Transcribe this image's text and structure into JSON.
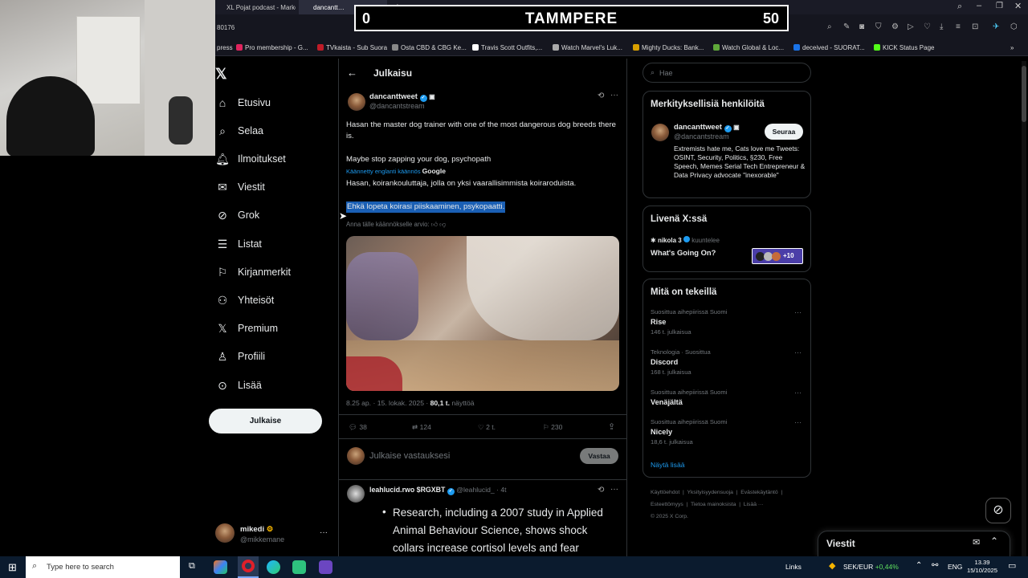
{
  "browser": {
    "tabs": [
      "XL Pojat podcast - Marko",
      "dancantt…"
    ],
    "address_text": "80176",
    "bookmarks": [
      "press",
      "Pro membership - G...",
      "TVkaista - Sub Suora",
      "Osta CBD & CBG Ke...",
      "Travis Scott Outfits,...",
      "Watch Marvel's Luk...",
      "Mighty Ducks: Bank...",
      "Watch Global & Loc...",
      "deceived - SUORAT...",
      "KICK Status Page"
    ]
  },
  "scoreboard": {
    "left": "0",
    "center": "TAMMPERE",
    "right": "50"
  },
  "nav": {
    "items": [
      {
        "label": "Etusivu",
        "icon": "home-icon"
      },
      {
        "label": "Selaa",
        "icon": "search-icon"
      },
      {
        "label": "Ilmoitukset",
        "icon": "bell-icon"
      },
      {
        "label": "Viestit",
        "icon": "mail-icon"
      },
      {
        "label": "Grok",
        "icon": "grok-icon"
      },
      {
        "label": "Listat",
        "icon": "list-icon"
      },
      {
        "label": "Kirjanmerkit",
        "icon": "bookmark-icon"
      },
      {
        "label": "Yhteisöt",
        "icon": "people-icon"
      },
      {
        "label": "Premium",
        "icon": "x-logo-icon"
      },
      {
        "label": "Profiili",
        "icon": "person-icon"
      },
      {
        "label": "Lisää",
        "icon": "more-circle-icon"
      }
    ],
    "post_button": "Julkaise",
    "account": {
      "name": "mikedi",
      "handle": "@mikkemane"
    }
  },
  "post": {
    "header_title": "Julkaisu",
    "author_name": "dancanttweet",
    "author_handle": "@dancantstream",
    "text1": "Hasan the master dog trainer with one of the most dangerous dog breeds there is.",
    "text2": "Maybe stop zapping your dog, psychopath",
    "translated_note": "Käännetty englanti käännös",
    "translated_by": "Google",
    "translation1": "Hasan, koirankouluttaja, jolla on yksi vaarallisimmista koiraroduista.",
    "translation2": "Ehkä lopeta koirasi piiskaaminen, psykopaatti.",
    "rate_translation": "Anna tälle käännökselle arvio:",
    "timestamp": "8.25 ap. · 15. lokak. 2025 · ",
    "views_count": "80,1 t.",
    "views_label": " näyttöä",
    "stats": {
      "replies": "38",
      "reposts": "124",
      "likes": "2 t.",
      "bookmarks": "230"
    },
    "reply_placeholder": "Julkaise vastauksesi",
    "reply_button": "Vastaa"
  },
  "reply": {
    "author_name": "leahlucid.rwo",
    "author_badge": "$RGXBT",
    "author_handle": "@leahlucid_ · 4t",
    "bullet_text": "Research, including a 2007 study in Applied Animal Behaviour Science, shows shock collars increase cortisol levels and fear"
  },
  "sidebar": {
    "search_placeholder": "Hae",
    "relevant": {
      "title": "Merkityksellisiä henkilöitä",
      "name": "dancanttweet",
      "handle": "@dancantstream",
      "follow": "Seuraa",
      "bio": "Extremists hate me, Cats love me Tweets: OSINT, Security, Politics, §230, Free Speech, Memes Serial Tech Entrepreneur & Data Privacy advocate \"inexorable\""
    },
    "live": {
      "title": "Livenä X:ssä",
      "host": "nikola 3",
      "host_suffix": "kuuntelee",
      "space_title": "What's Going On?",
      "count": "+10"
    },
    "trends": {
      "title": "Mitä on tekeillä",
      "items": [
        {
          "context": "Suosittua aihepiirissä Suomi",
          "name": "Rise",
          "count": "146 t. julkaisua"
        },
        {
          "context": "Teknologia · Suosittua",
          "name": "Discord",
          "count": "168 t. julkaisua"
        },
        {
          "context": "Suosittua aihepiirissä Suomi",
          "name": "Venäjältä",
          "count": ""
        },
        {
          "context": "Suosittua aihepiirissä Suomi",
          "name": "Nicely",
          "count": "18,6 t. julkaisua"
        }
      ],
      "show_more": "Näytä lisää"
    },
    "footer": [
      "Käyttöehdot",
      "Yksityisyydensuoja",
      "Evästekäytäntö",
      "Esteettömyys",
      "Tietoa mainoksista",
      "Lisää ···",
      "© 2025 X Corp."
    ]
  },
  "messages_drawer": {
    "title": "Viestit"
  },
  "taskbar": {
    "search_placeholder": "Type here to search",
    "links": "Links",
    "ticker": "SEK/EUR",
    "ticker_change": "+0,44%",
    "lang": "ENG",
    "time": "13.39",
    "date": "15/10/2025"
  },
  "colors": {
    "accent": "#1d9bf0",
    "background": "#000000",
    "border": "#2f3336",
    "highlight": "#1a5fb4"
  }
}
